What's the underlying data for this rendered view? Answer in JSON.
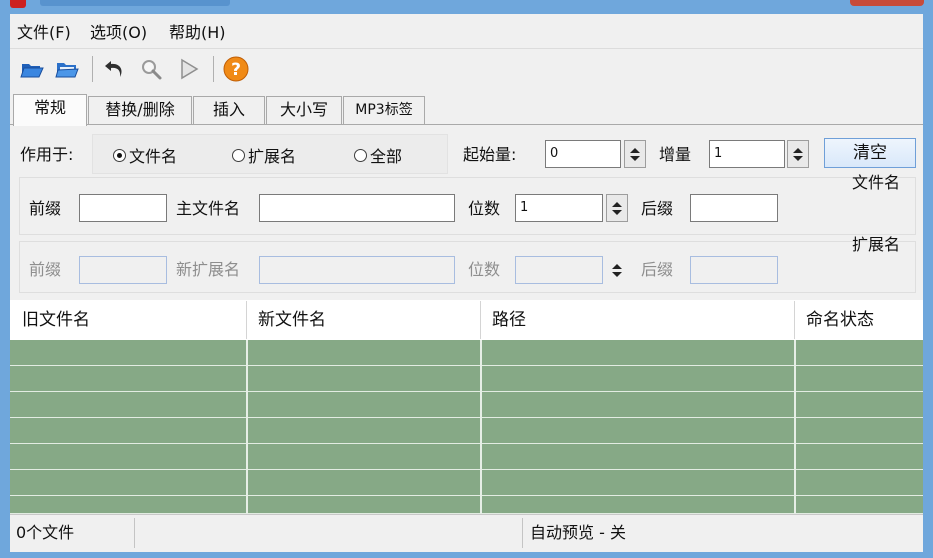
{
  "menu": {
    "file": "文件(F)",
    "options": "选项(O)",
    "help": "帮助(H)"
  },
  "toolbar": {
    "icons": [
      "folder-open-icon",
      "folder-blue-icon",
      "undo-icon",
      "search-icon",
      "play-icon",
      "help-icon"
    ]
  },
  "tabs": [
    "常规",
    "替换/删除",
    "插入",
    "大小写",
    "MP3标签"
  ],
  "general": {
    "apply_to_label": "作用于:",
    "radio_filename": "文件名",
    "radio_extension": "扩展名",
    "radio_all": "全部",
    "start_label": "起始量:",
    "start_value": "0",
    "increment_label": "增量",
    "increment_value": "1",
    "clear_button": "清空",
    "filename_group_title": "文件名",
    "extension_group_title": "扩展名",
    "filename_row": {
      "prefix": "前缀",
      "main_name": "主文件名",
      "digits": "位数",
      "digits_value": "1",
      "suffix": "后缀"
    },
    "extension_row": {
      "prefix": "前缀",
      "new_ext": "新扩展名",
      "digits": "位数",
      "suffix": "后缀"
    }
  },
  "table": {
    "columns": [
      "旧文件名",
      "新文件名",
      "路径",
      "命名状态"
    ],
    "row_color": "#86a986"
  },
  "status": {
    "file_count": "0个文件",
    "auto_preview": "自动预览 - 关"
  }
}
